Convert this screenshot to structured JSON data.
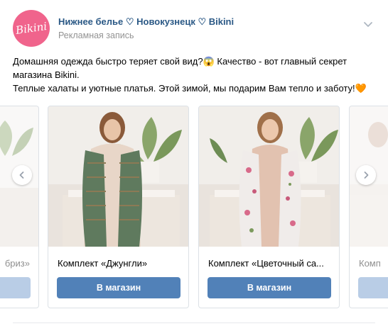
{
  "post": {
    "avatar_text": "Bikini",
    "author": "Нижнее белье ♡ Новокузнецк ♡ Bikini",
    "subtitle": "Рекламная запись",
    "text_lines": [
      "Домашняя одежда быстро теряет свой вид?😱 Качество - вот главный секрет",
      "магазина Bikini.",
      "Теплые халаты и уютные платья. Этой зимой, мы подарим Вам тепло и заботу!🧡"
    ]
  },
  "carousel": {
    "cards": [
      {
        "title": "бриз»",
        "button": "",
        "faded": true
      },
      {
        "title": "Комплект «Джунгли»",
        "button": "В магазин",
        "faded": false
      },
      {
        "title": "Комплект «Цветочный са...",
        "button": "В магазин",
        "faded": false
      },
      {
        "title": "Комп",
        "button": "",
        "faded": true
      }
    ]
  },
  "icons": [
    "chevron-down-icon",
    "arrow-left-icon",
    "arrow-right-icon"
  ],
  "colors": {
    "link": "#2a5885",
    "button": "#5181b8",
    "avatar": "#f0648c",
    "muted": "#939393"
  }
}
